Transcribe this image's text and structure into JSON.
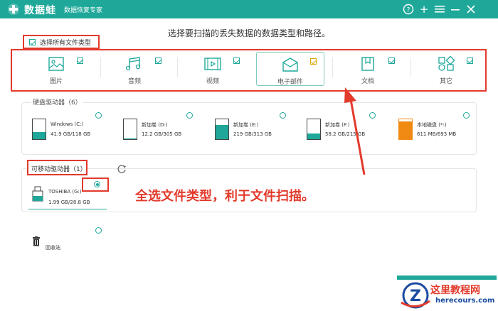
{
  "app": {
    "name": "数据蛙",
    "subtitle": "数据恢复专家",
    "controls": [
      "help-icon",
      "plus-icon",
      "menu-icon",
      "minimize-icon",
      "close-icon"
    ]
  },
  "instruction": "选择要扫描的丢失数据的数据类型和路径。",
  "select_all": {
    "label": "选择所有文件类型",
    "checked": true
  },
  "file_types": [
    {
      "label": "图片",
      "icon": "picture-icon",
      "checked": true
    },
    {
      "label": "音频",
      "icon": "audio-icon",
      "checked": true
    },
    {
      "label": "视频",
      "icon": "video-icon",
      "checked": true
    },
    {
      "label": "电子邮件",
      "icon": "email-icon",
      "checked": true
    },
    {
      "label": "文档",
      "icon": "document-icon",
      "checked": true
    },
    {
      "label": "其它",
      "icon": "other-icon",
      "checked": true
    }
  ],
  "hard_drives": {
    "title": "硬盘驱动器（6）",
    "items": [
      {
        "name": "Windows (C:)",
        "size": "41.9 GB/118 GB",
        "used_fraction": 0.36
      },
      {
        "name": "新加卷 (D:)",
        "size": "12.2 GB/305 GB",
        "used_fraction": 0.04
      },
      {
        "name": "新加卷 (E:)",
        "size": "219 GB/313 GB",
        "used_fraction": 0.7
      },
      {
        "name": "新加卷 (F:)",
        "size": "58.2 GB/215 GB",
        "used_fraction": 0.27
      },
      {
        "name": "本地磁盘 (*:)",
        "size": "611 MB/693 MB",
        "used_fraction": 0.88
      }
    ]
  },
  "removable": {
    "title": "可移动驱动器（1）",
    "items": [
      {
        "name": "TOSHIBA (G:)",
        "size": "1.99 GB/28.8 GB",
        "selected": true
      }
    ]
  },
  "recycle_bin": {
    "label": "回收站"
  },
  "annotation": "全选文件类型，利于文件扫描。",
  "watermark": {
    "brand": "这里教程网",
    "site": "herecours.com"
  },
  "colors": {
    "accent": "#1fa89a",
    "annotation_red": "#e23a2b",
    "orange_drive": "#f08a12"
  }
}
